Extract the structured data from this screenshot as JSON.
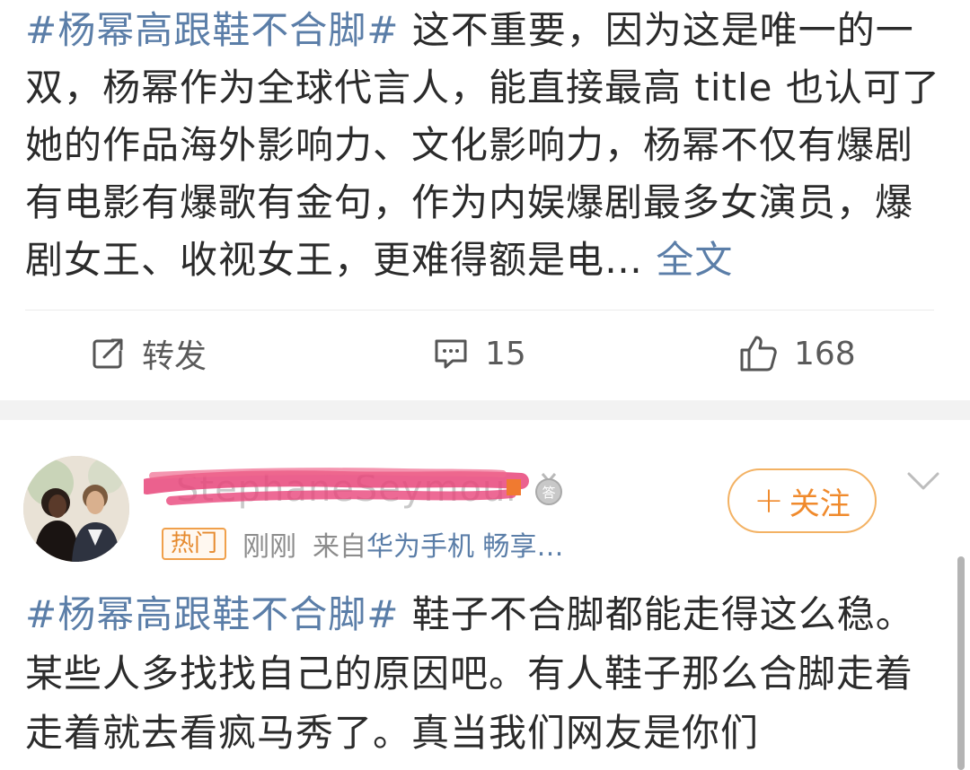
{
  "post": {
    "hashtag": "#杨幂高跟鞋不合脚#",
    "text": " 这不重要，因为这是唯一的一双，杨幂作为全球代言人，能直接最高 title 也认可了她的作品海外影响力、文化影响力，杨幂不仅有爆剧有电影有爆歌有金句，作为内娱爆剧最多女演员，爆剧女王、收视女王，更难得额是电… ",
    "more_label": "全文"
  },
  "actions": {
    "repost_label": "转发",
    "comment_count": "15",
    "like_count": "168",
    "repost_icon": "share-edit-icon",
    "comment_icon": "comment-bubble-icon",
    "like_icon": "thumbs-up-icon"
  },
  "comment": {
    "username": "StephaneSeymour",
    "badge_icon": "answer-badge-icon",
    "follow_label": "关注",
    "follow_plus": "+",
    "hot_tag": "热门",
    "time": "刚刚",
    "from_prefix": "来自",
    "device": "华为手机 畅享…",
    "hashtag": "#杨幂高跟鞋不合脚#",
    "text": " 鞋子不合脚都能走得这么稳。某些人多找找自己的原因吧。有人鞋子那么合脚走着走着就去看疯马秀了。真当我们网友是你们"
  },
  "colors": {
    "link": "#5b7ea8",
    "accent_orange": "#f08a2c",
    "scribble_pink": "#e8457a",
    "text": "#2b2b2b"
  }
}
